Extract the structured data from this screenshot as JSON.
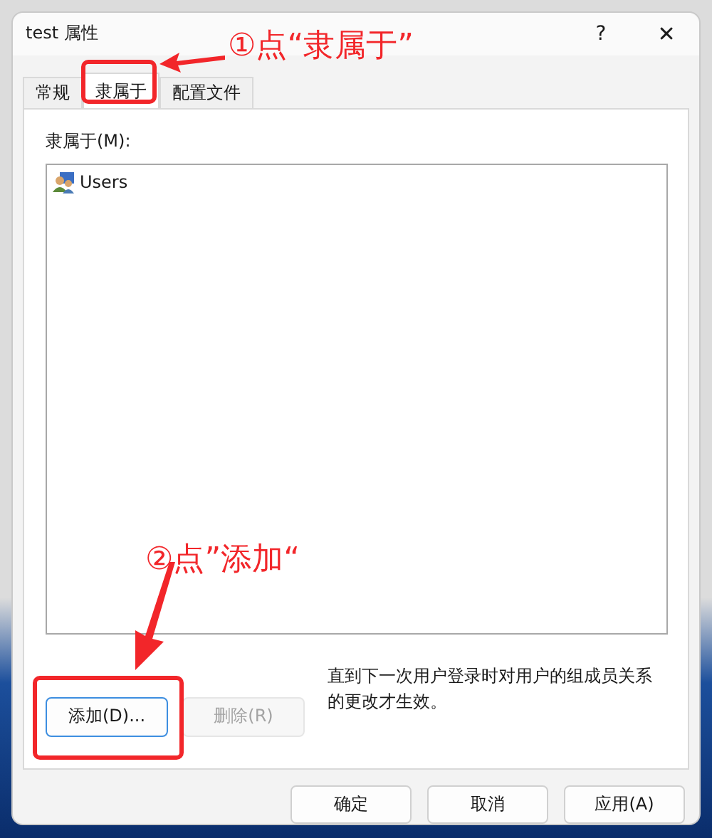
{
  "window": {
    "title": "test 属性",
    "help": "?",
    "close": "✕"
  },
  "tabs": [
    {
      "label": "常规",
      "selected": false
    },
    {
      "label": "隶属于",
      "selected": true
    },
    {
      "label": "配置文件",
      "selected": false
    }
  ],
  "member_of": {
    "label": "隶属于(M):",
    "items": [
      {
        "name": "Users",
        "selected": false
      }
    ]
  },
  "actions": [
    {
      "label": "添加(D)...",
      "disabled": false
    },
    {
      "label": "删除(R)",
      "disabled": true
    }
  ],
  "note": "直到下一次用户登录时对用户的组成员关系的更改才生效。",
  "buttons": [
    {
      "label": "确定"
    },
    {
      "label": "取消"
    },
    {
      "label": "应用(A)"
    }
  ],
  "annotations": [
    {
      "text": "①点“隶属于”"
    },
    {
      "text": "②点”添加“"
    }
  ]
}
